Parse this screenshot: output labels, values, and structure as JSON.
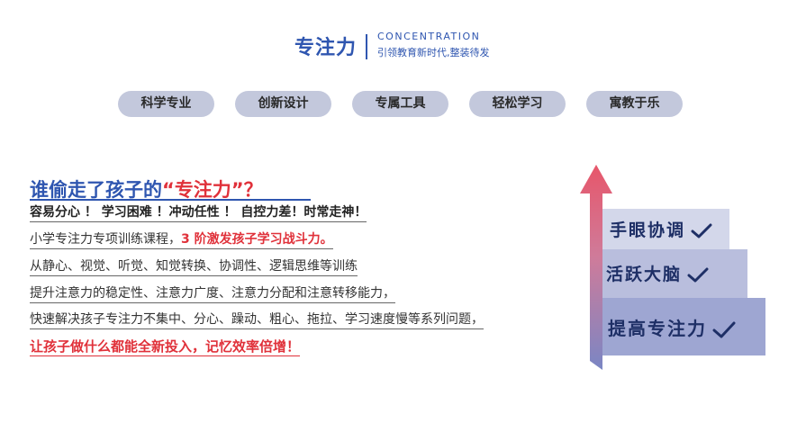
{
  "header": {
    "title": "专注力",
    "subtitle_en": "CONCENTRATION",
    "slogan": "引领教育新时代,整装待发"
  },
  "tags": [
    "科学专业",
    "创新设计",
    "专属工具",
    "轻松学习",
    "寓教于乐"
  ],
  "headline": {
    "prefix": "谁偷走了孩子的",
    "quote_open": "“",
    "highlight": "专注力",
    "quote_close": "”？"
  },
  "lines": {
    "line1": "容易分心 ！ 学习困难 ！冲动任性 ！ 自控力差！时常走神！",
    "line2_prefix": "小学专注力专项训练课程，",
    "line2_highlight": "3 阶激发孩子学习战斗力。",
    "line3": "从静心、视觉、听觉、知觉转换、协调性、逻辑思维等训练",
    "line4": "提升注意力的稳定性、注意力广度、注意力分配和注意转移能力，",
    "line5": "快速解决孩子专注力不集中、分心、躁动、粗心、拖拉、学习速度慢等系列问题，",
    "line6": "让孩子做什么都能全新投入，记忆效率倍增！"
  },
  "steps": [
    "手眼协调",
    "活跃大脑",
    "提高专注力"
  ],
  "colors": {
    "brand_blue": "#2f56b0",
    "accent_red": "#e0313a",
    "pill_bg": "#c3c8dc",
    "step_top": "#d3d7ea",
    "step_mid": "#b9bedd",
    "step_bottom": "#9ea6d2"
  },
  "icons": [
    "check-icon",
    "up-arrow-icon"
  ]
}
